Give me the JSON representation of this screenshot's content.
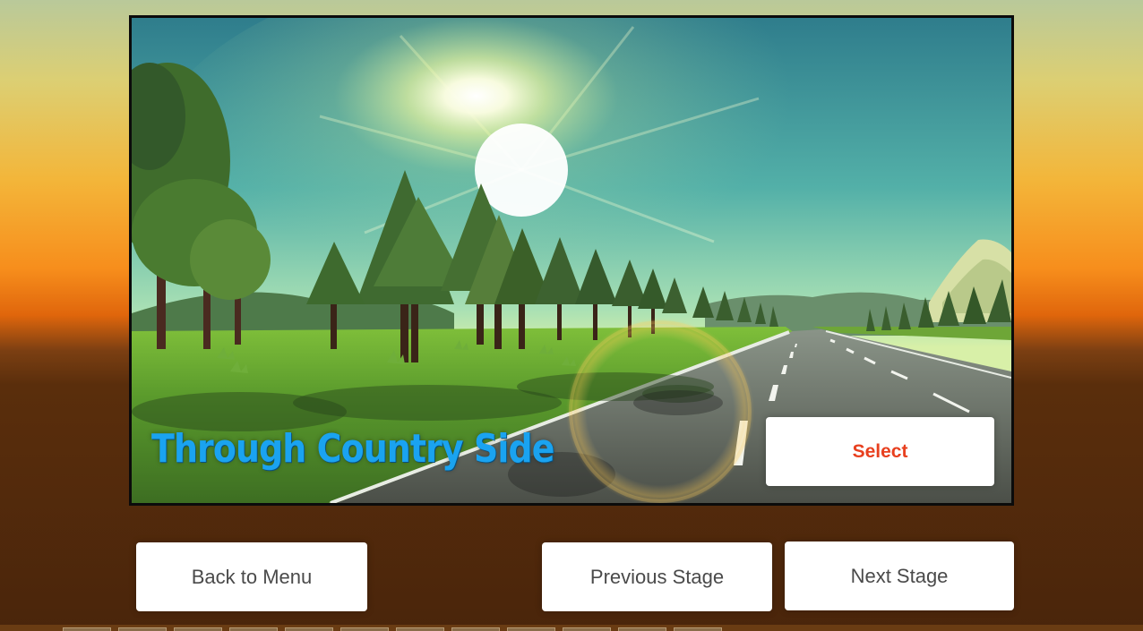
{
  "stage": {
    "title": "Through Country Side",
    "select_label": "Select",
    "title_color": "#1aa3f0"
  },
  "nav": {
    "back_label": "Back to Menu",
    "previous_label": "Previous Stage",
    "next_label": "Next Stage"
  },
  "colors": {
    "select_text": "#e8401f",
    "button_text": "#4a4a4a",
    "button_bg": "#ffffff",
    "frame_border": "#0b0b0b"
  }
}
